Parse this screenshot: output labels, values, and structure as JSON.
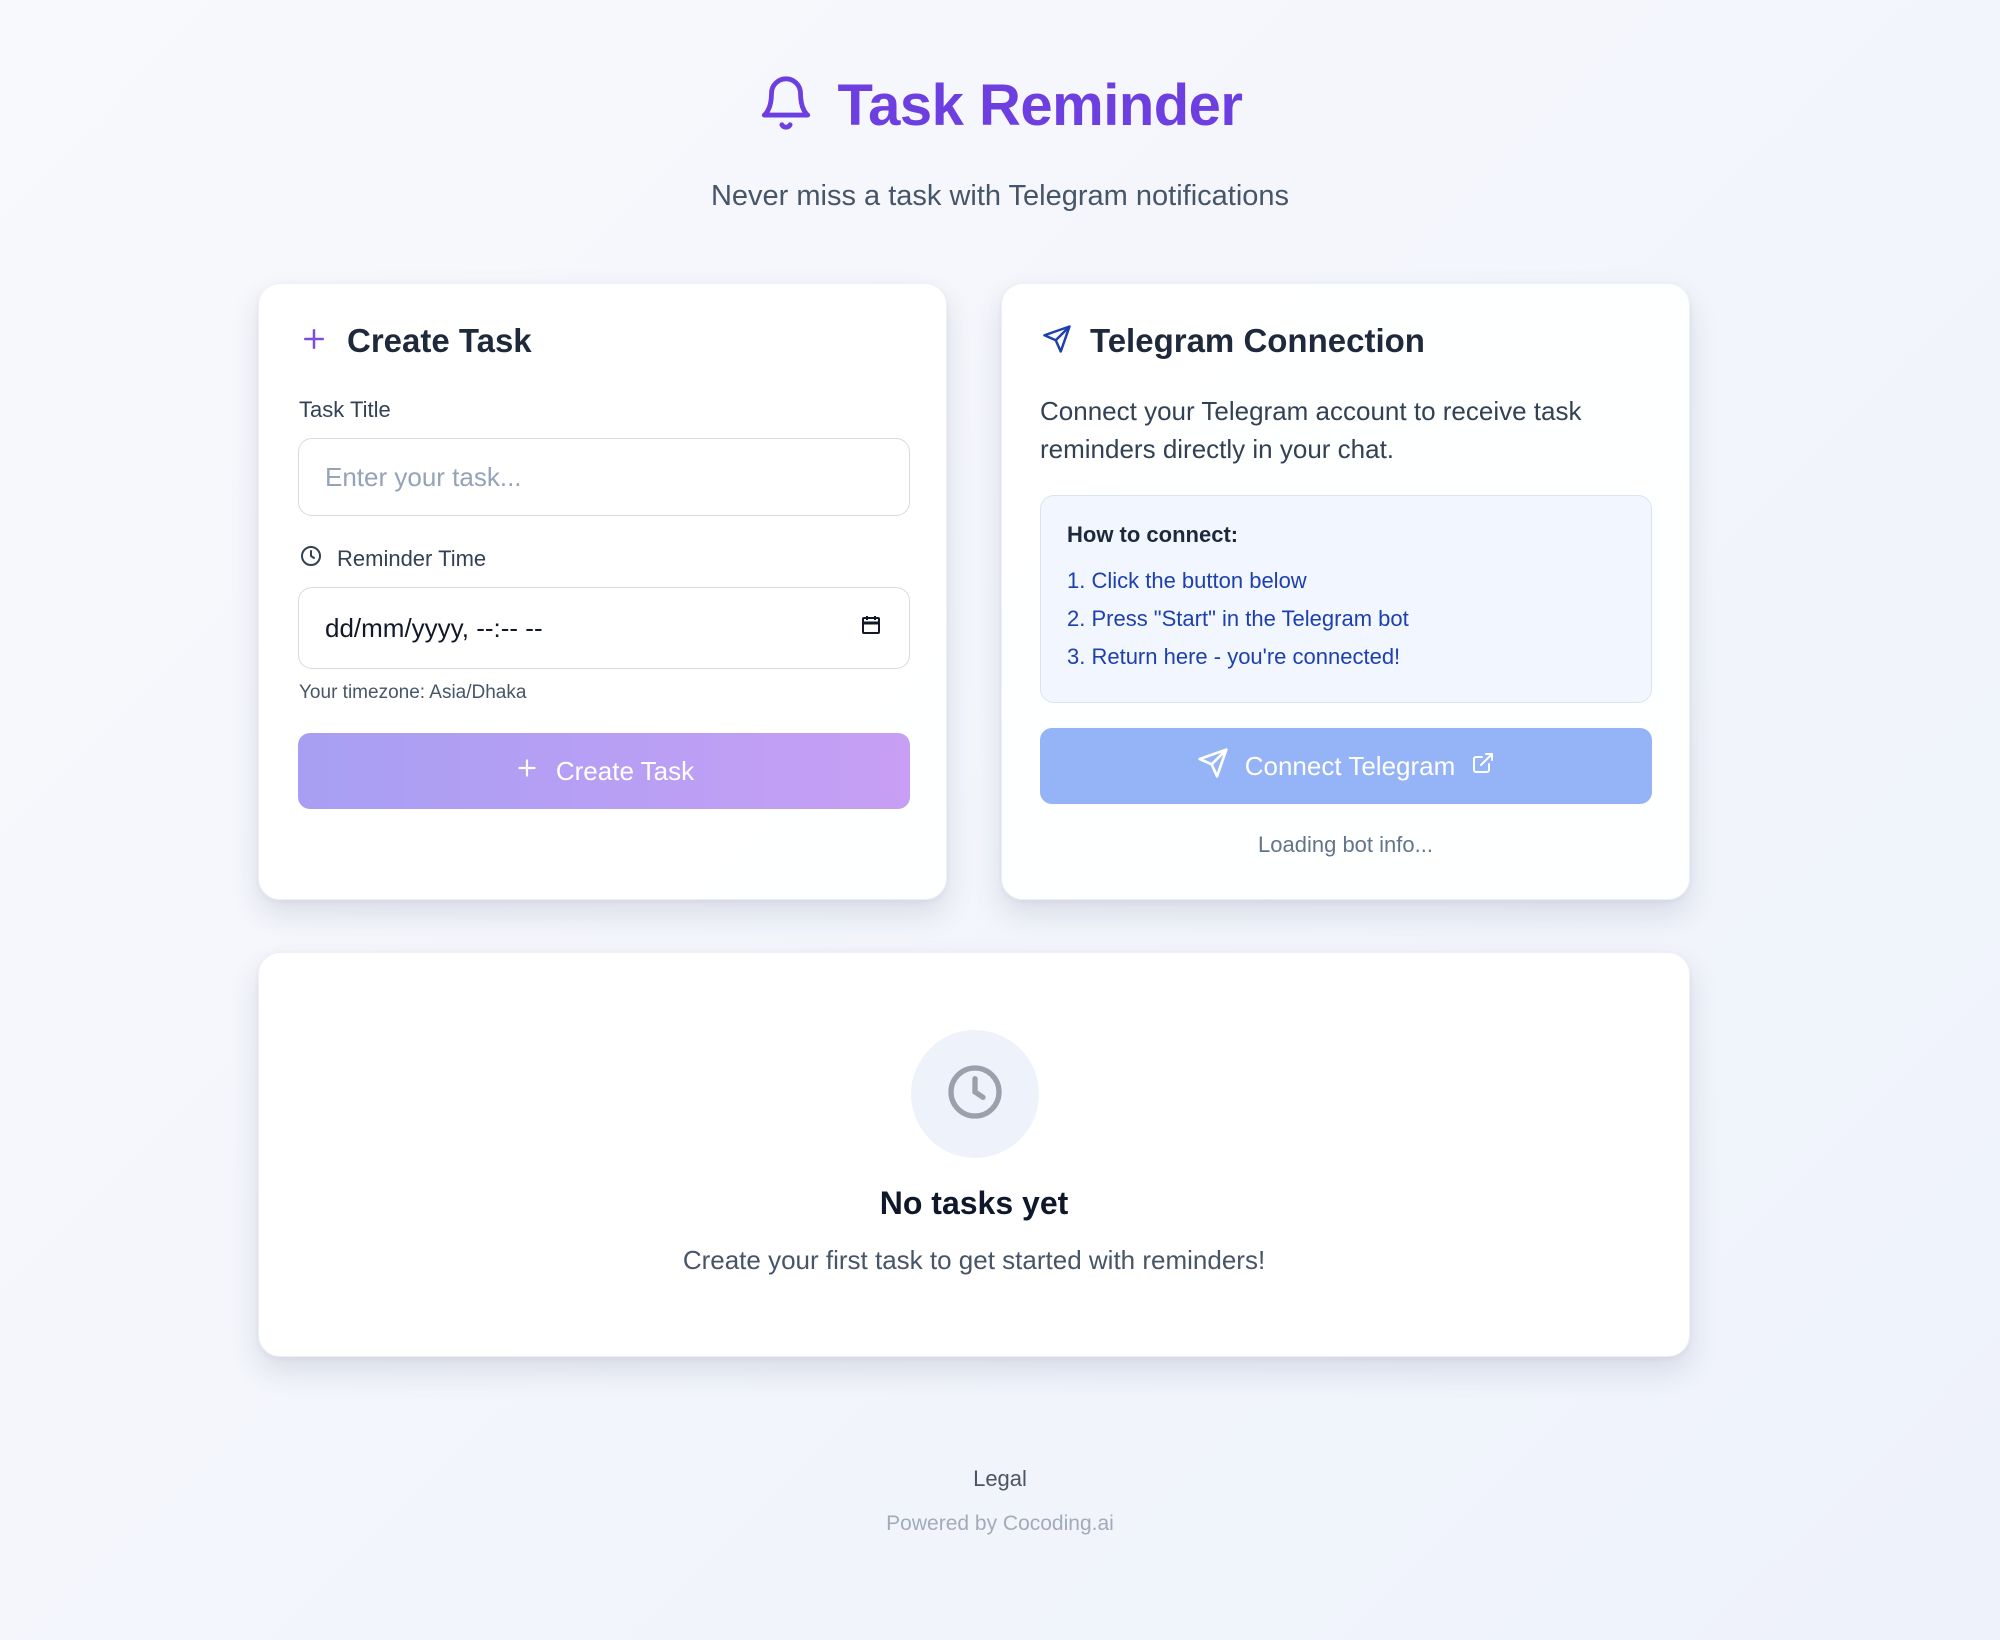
{
  "header": {
    "title": "Task Reminder",
    "subtitle": "Never miss a task with Telegram notifications",
    "icon": "bell-icon"
  },
  "create_task": {
    "heading": "Create Task",
    "title_label": "Task Title",
    "title_placeholder": "Enter your task...",
    "time_label": "Reminder Time",
    "date_value": "dd/mm/yyyy, --:-- --",
    "timezone_text": "Your timezone: Asia/Dhaka",
    "button_label": "Create Task"
  },
  "telegram": {
    "heading": "Telegram Connection",
    "description": "Connect your Telegram account to receive task reminders directly in your chat.",
    "howto_title": "How to connect:",
    "steps": [
      "1. Click the button below",
      "2. Press \"Start\" in the Telegram bot",
      "3. Return here - you're connected!"
    ],
    "button_label": "Connect Telegram",
    "status": "Loading bot info..."
  },
  "tasks": {
    "empty_title": "No tasks yet",
    "empty_subtitle": "Create your first task to get started with reminders!"
  },
  "footer": {
    "legal": "Legal",
    "powered": "Powered by Cocoding.ai"
  },
  "colors": {
    "accent": "#6d3fe0",
    "create_button": "#b49ff4",
    "telegram_button": "#95b3f7",
    "step_text": "#1e40af"
  }
}
